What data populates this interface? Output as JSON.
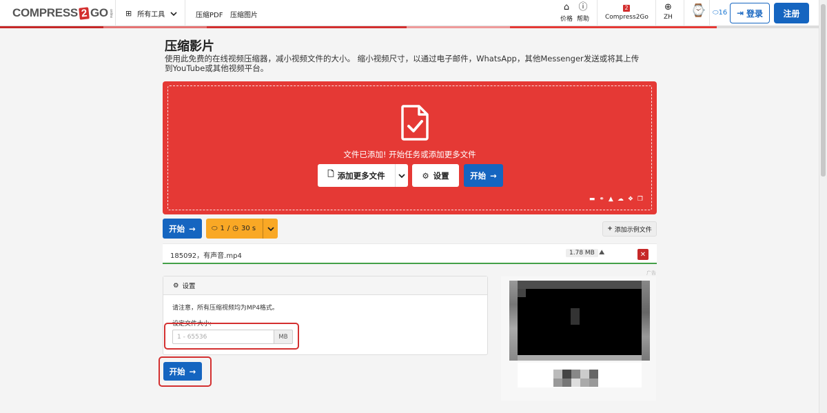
{
  "header": {
    "logo": {
      "pre": "COMPRESS",
      "two": "2",
      "post": "GO",
      "small": "online"
    },
    "all_tools_label": "所有工具",
    "nav": [
      {
        "label": "压缩PDF"
      },
      {
        "label": "压缩图片"
      }
    ],
    "pricing_label": "价格",
    "help_label": "帮助",
    "brand_label": "Compress2Go",
    "lang_label": "ZH",
    "counter": "16",
    "login_label": "登录",
    "register_label": "注册"
  },
  "page": {
    "title": "压缩影片",
    "description": "使用此免费的在线视频压缩器，减小视频文件的大小。 缩小视频尺寸，以通过电子邮件，WhatsApp，其他Messenger发送或将其上传到YouTube或其他视频平台。"
  },
  "dropzone": {
    "status": "文件已添加! 开始任务或添加更多文件",
    "add_more_label": "添加更多文件",
    "settings_label": "设置",
    "start_label": "开始"
  },
  "toolbar": {
    "start_label": "开始",
    "limit_files": "1",
    "limit_time": "30 s",
    "add_sample_label": "添加示例文件"
  },
  "file": {
    "name": "185092，有声音.mp4",
    "size": "1.78 MB"
  },
  "settings": {
    "header": "设置",
    "note": "请注意，所有压缩视频均为MP4格式。",
    "target_size_label": "设定文件大小:",
    "target_size_placeholder": "1 - 65536",
    "unit": "MB"
  },
  "bottom_start_label": "开始",
  "ad_label": "广告",
  "colors": {
    "brand_red": "#e53935",
    "primary_blue": "#1565c0",
    "limit_yellow": "#f9a825",
    "success_green": "#43a047"
  }
}
